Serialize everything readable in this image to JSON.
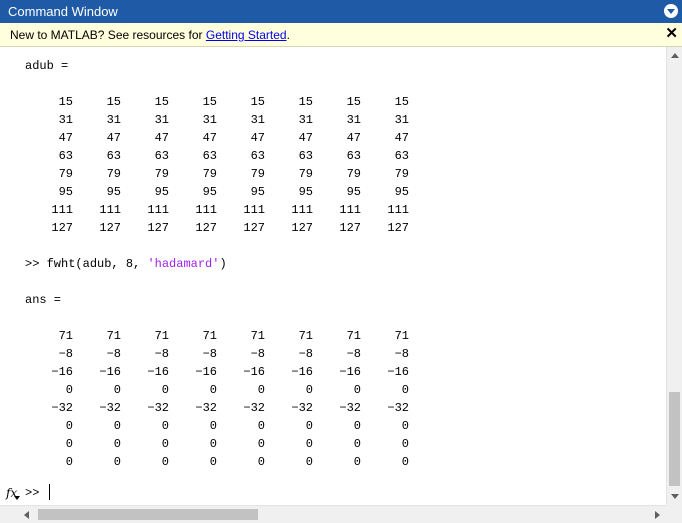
{
  "window": {
    "title": "Command Window"
  },
  "notice": {
    "prefix": "New to MATLAB? See resources for ",
    "link": "Getting Started",
    "suffix": ".",
    "close": "✕"
  },
  "console": {
    "adub_header": "adub =",
    "adub_rows": [
      [
        "15",
        "15",
        "15",
        "15",
        "15",
        "15",
        "15",
        "15"
      ],
      [
        "31",
        "31",
        "31",
        "31",
        "31",
        "31",
        "31",
        "31"
      ],
      [
        "47",
        "47",
        "47",
        "47",
        "47",
        "47",
        "47",
        "47"
      ],
      [
        "63",
        "63",
        "63",
        "63",
        "63",
        "63",
        "63",
        "63"
      ],
      [
        "79",
        "79",
        "79",
        "79",
        "79",
        "79",
        "79",
        "79"
      ],
      [
        "95",
        "95",
        "95",
        "95",
        "95",
        "95",
        "95",
        "95"
      ],
      [
        "111",
        "111",
        "111",
        "111",
        "111",
        "111",
        "111",
        "111"
      ],
      [
        "127",
        "127",
        "127",
        "127",
        "127",
        "127",
        "127",
        "127"
      ]
    ],
    "command": {
      "prompt": ">> ",
      "code": "fwht(adub, 8, ",
      "string_arg": "'hadamard'",
      "close": ")"
    },
    "ans_header": "ans =",
    "ans_rows": [
      [
        "71",
        "71",
        "71",
        "71",
        "71",
        "71",
        "71",
        "71"
      ],
      [
        "−8",
        "−8",
        "−8",
        "−8",
        "−8",
        "−8",
        "−8",
        "−8"
      ],
      [
        "−16",
        "−16",
        "−16",
        "−16",
        "−16",
        "−16",
        "−16",
        "−16"
      ],
      [
        "0",
        "0",
        "0",
        "0",
        "0",
        "0",
        "0",
        "0"
      ],
      [
        "−32",
        "−32",
        "−32",
        "−32",
        "−32",
        "−32",
        "−32",
        "−32"
      ],
      [
        "0",
        "0",
        "0",
        "0",
        "0",
        "0",
        "0",
        "0"
      ],
      [
        "0",
        "0",
        "0",
        "0",
        "0",
        "0",
        "0",
        "0"
      ],
      [
        "0",
        "0",
        "0",
        "0",
        "0",
        "0",
        "0",
        "0"
      ]
    ],
    "input_prompt": ">>",
    "fx_label": "fx"
  },
  "icons": {
    "window_menu": "chevron-down-icon",
    "close": "close-icon",
    "function_browser": "fx-icon"
  }
}
